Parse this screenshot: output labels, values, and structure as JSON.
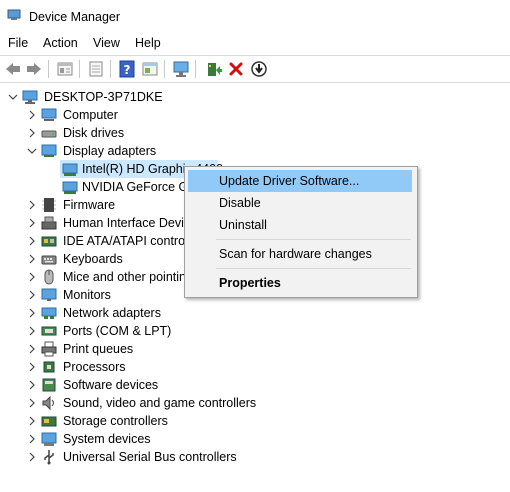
{
  "window": {
    "title": "Device Manager"
  },
  "menu": [
    "File",
    "Action",
    "View",
    "Help"
  ],
  "toolbar": {
    "buttons": [
      "back-icon",
      "forward-icon",
      "properties-icon",
      "print-icon",
      "help-icon",
      "show-hide-icon",
      "scan-computer-icon",
      "update-driver-icon",
      "uninstall-icon",
      "disable-icon"
    ]
  },
  "tree": {
    "root": "DESKTOP-3P71DKE",
    "categories": [
      "Computer",
      "Disk drives",
      "Display adapters",
      "Firmware",
      "Human Interface Devic",
      "IDE ATA/ATAPI controll",
      "Keyboards",
      "Mice and other pointin",
      "Monitors",
      "Network adapters",
      "Ports (COM & LPT)",
      "Print queues",
      "Processors",
      "Software devices",
      "Sound, video and game controllers",
      "Storage controllers",
      "System devices",
      "Universal Serial Bus controllers"
    ],
    "display_children": [
      "Intel(R) HD Graphic  4400",
      "NVIDIA GeForce GT"
    ]
  },
  "context_menu": {
    "update": "Update Driver Software...",
    "disable": "Disable",
    "uninstall": "Uninstall",
    "scan": "Scan for hardware changes",
    "properties": "Properties"
  }
}
